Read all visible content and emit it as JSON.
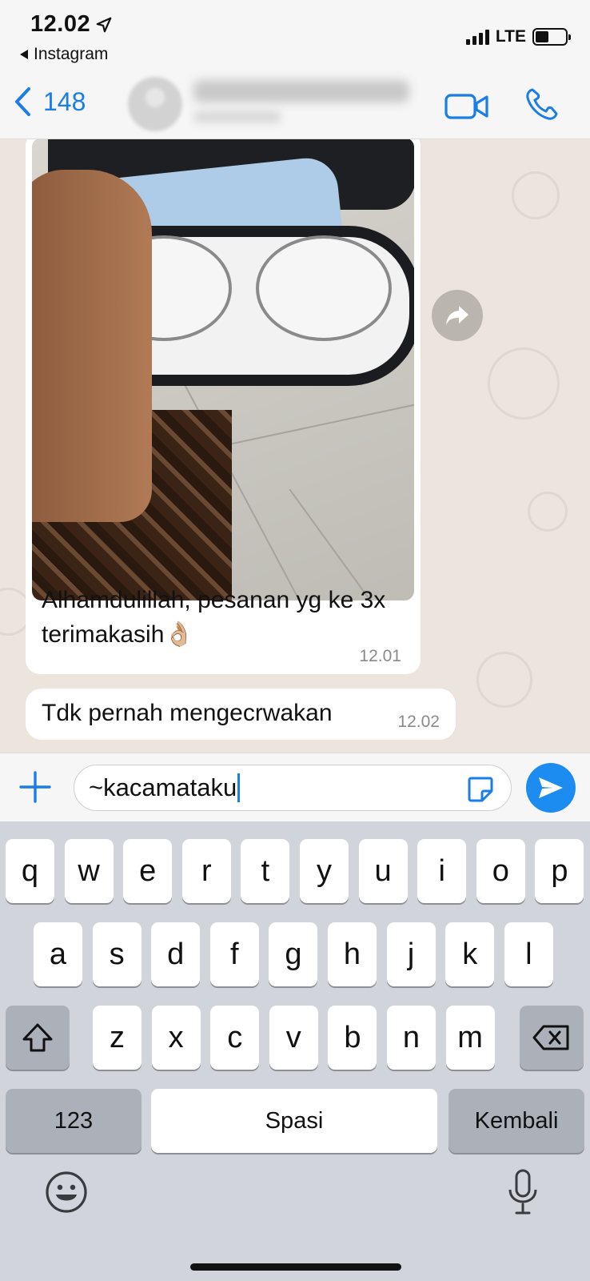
{
  "status_bar": {
    "time": "12.02",
    "back_app": "Instagram",
    "network": "LTE",
    "battery_level": 0.45
  },
  "chat_header": {
    "back_count": "148",
    "contact_name_blurred": true
  },
  "messages": [
    {
      "type": "image",
      "caption": "Alhamdulillah, pesanan yg ke 3x terimakasih👌🏼",
      "time": "12.01"
    },
    {
      "type": "text",
      "text": "Tdk pernah mengecrwakan",
      "time": "12.02"
    }
  ],
  "composer": {
    "value": "~kacamataku"
  },
  "keyboard": {
    "row1": [
      "q",
      "w",
      "e",
      "r",
      "t",
      "y",
      "u",
      "i",
      "o",
      "p"
    ],
    "row2": [
      "a",
      "s",
      "d",
      "f",
      "g",
      "h",
      "j",
      "k",
      "l"
    ],
    "row3": [
      "z",
      "x",
      "c",
      "v",
      "b",
      "n",
      "m"
    ],
    "numbers_label": "123",
    "space_label": "Spasi",
    "return_label": "Kembali"
  },
  "colors": {
    "accent": "#1a7ee6",
    "chat_bg": "#ece5dd",
    "send": "#1d8cf0",
    "keyboard_bg": "#d1d4da"
  },
  "icons": [
    "location-arrow-icon",
    "back-chevron-icon",
    "video-call-icon",
    "phone-call-icon",
    "forward-icon",
    "plus-icon",
    "sticker-icon",
    "send-icon",
    "shift-icon",
    "backspace-icon",
    "emoji-icon",
    "microphone-icon"
  ]
}
